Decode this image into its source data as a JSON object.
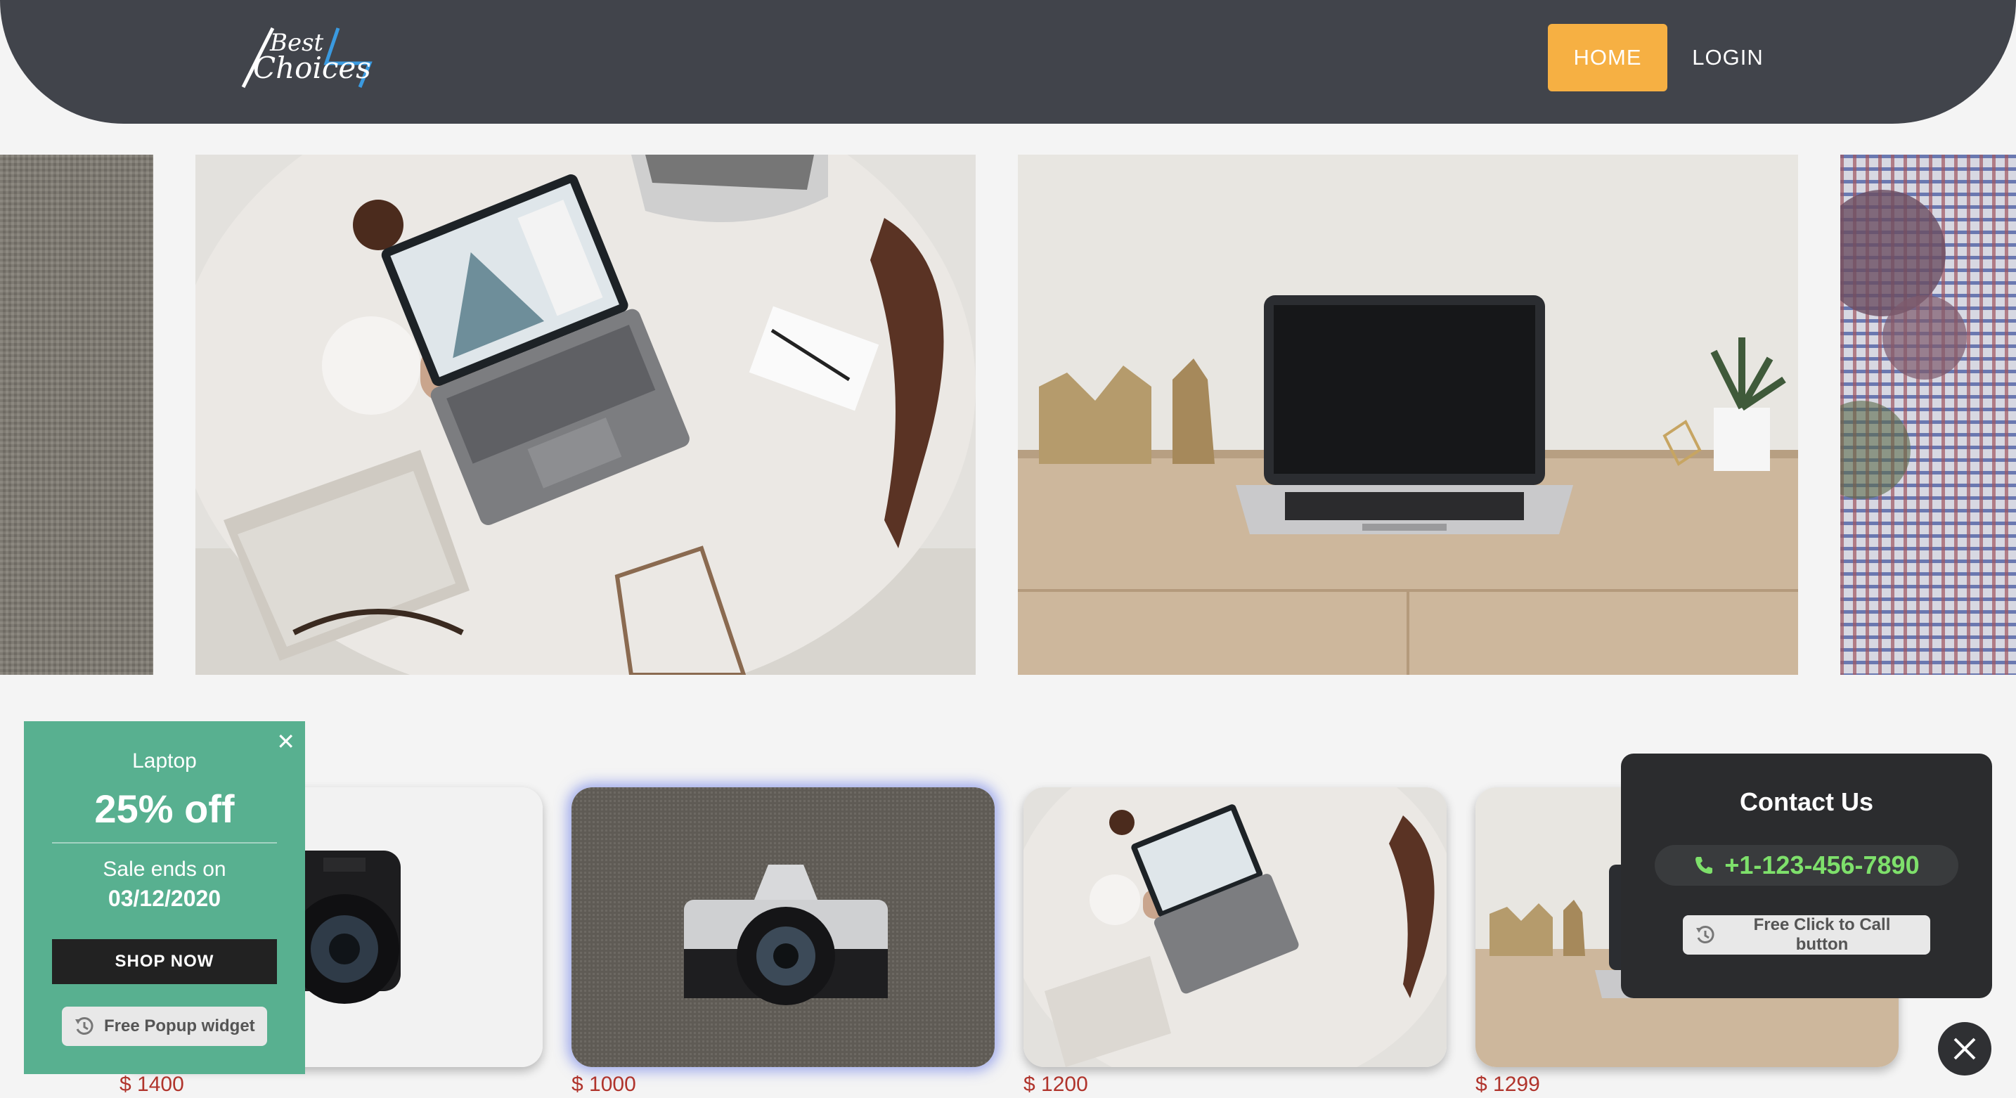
{
  "header": {
    "logo_word1": "Best",
    "logo_word2": "Choices",
    "nav": {
      "home": "HOME",
      "login": "LOGIN"
    },
    "colors": {
      "bar": "#41444b",
      "active": "#f6b043"
    }
  },
  "carousel": {
    "slides": [
      {
        "image": "fabric-texture-photo"
      },
      {
        "image": "laptop-on-round-table-photo"
      },
      {
        "image": "laptop-on-wooden-desk-photo"
      },
      {
        "image": "plaid-fabric-with-plant-photo"
      }
    ]
  },
  "products": [
    {
      "image": "canon-dslr-camera-photo",
      "price": "$ 1400"
    },
    {
      "image": "canon-film-camera-photo",
      "price": "$ 1000"
    },
    {
      "image": "laptop-on-round-table-photo",
      "price": "$ 1200"
    },
    {
      "image": "laptop-on-wooden-desk-photo",
      "price": "$ 1299"
    }
  ],
  "popup": {
    "product": "Laptop",
    "offer": "25% off",
    "sale_label": "Sale ends on",
    "sale_date": "03/12/2020",
    "cta": "SHOP NOW",
    "badge": "Free Popup widget",
    "close_icon": "close-icon",
    "color": "#58b090"
  },
  "contact": {
    "title": "Contact Us",
    "phone": "+1-123-456-7890",
    "phone_icon": "phone-icon",
    "badge": "Free Click to Call button",
    "color": "#2b2c2e"
  },
  "close_button": {
    "icon": "close-icon"
  }
}
